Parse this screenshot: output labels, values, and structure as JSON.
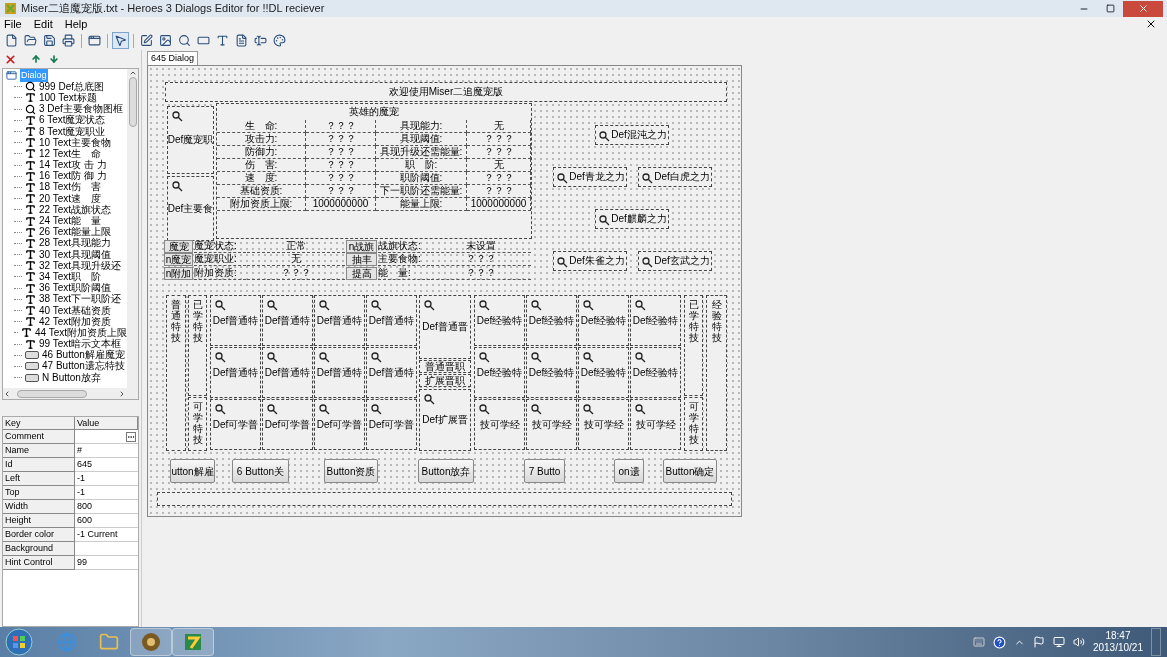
{
  "window": {
    "title": "Miser二追魔宠版.txt - Heroes 3 Dialogs Editor for !!DL reciever"
  },
  "menu": [
    {
      "label": "File"
    },
    {
      "label": "Edit"
    },
    {
      "label": "Help"
    }
  ],
  "toolbar": [
    {
      "kind": "new",
      "selected": false
    },
    {
      "kind": "open",
      "selected": false
    },
    {
      "kind": "save",
      "selected": false
    },
    {
      "kind": "print",
      "selected": false
    },
    {
      "kind": "dialog",
      "selected": false
    },
    {
      "kind": "pointer",
      "selected": true
    },
    {
      "kind": "edit",
      "selected": false
    },
    {
      "kind": "image",
      "selected": false
    },
    {
      "kind": "def",
      "selected": false
    },
    {
      "kind": "button",
      "selected": false
    },
    {
      "kind": "text",
      "selected": false
    },
    {
      "kind": "list",
      "selected": false
    },
    {
      "kind": "textbox",
      "selected": false
    },
    {
      "kind": "palette",
      "selected": false
    }
  ],
  "tree": {
    "label": "Dialog",
    "selected": true,
    "children": [
      {
        "kind": "def",
        "label": "999 Def总底图",
        "selected": false
      },
      {
        "kind": "text",
        "label": "100 Text标题",
        "selected": false
      },
      {
        "kind": "def",
        "label": "3 Def主要食物图框",
        "selected": false
      },
      {
        "kind": "text",
        "label": "6 Text魔宠状态",
        "selected": false
      },
      {
        "kind": "text",
        "label": "8 Text魔宠职业",
        "selected": false
      },
      {
        "kind": "text",
        "label": "10 Text主要食物",
        "selected": false
      },
      {
        "kind": "text",
        "label": "12 Text生　命",
        "selected": false
      },
      {
        "kind": "text",
        "label": "14 Text攻 击 力",
        "selected": false
      },
      {
        "kind": "text",
        "label": "16 Text防 御 力",
        "selected": false
      },
      {
        "kind": "text",
        "label": "18 Text伤　害",
        "selected": false
      },
      {
        "kind": "text",
        "label": "20 Text速　度",
        "selected": false
      },
      {
        "kind": "text",
        "label": "22 Text战旗状态",
        "selected": false
      },
      {
        "kind": "text",
        "label": "24 Text能　量",
        "selected": false
      },
      {
        "kind": "text",
        "label": "26 Text能量上限",
        "selected": false
      },
      {
        "kind": "text",
        "label": "28 Text具现能力",
        "selected": false
      },
      {
        "kind": "text",
        "label": "30 Text具现阈值",
        "selected": false
      },
      {
        "kind": "text",
        "label": "32 Text具现升级还",
        "selected": false
      },
      {
        "kind": "text",
        "label": "34 Text职　阶",
        "selected": false
      },
      {
        "kind": "text",
        "label": "36 Text职阶阈值",
        "selected": false
      },
      {
        "kind": "text",
        "label": "38 Text下一职阶还",
        "selected": false
      },
      {
        "kind": "text",
        "label": "40 Text基础资质",
        "selected": false
      },
      {
        "kind": "text",
        "label": "42 Text附加资质",
        "selected": false
      },
      {
        "kind": "text",
        "label": "44 Text附加资质上限",
        "selected": false
      },
      {
        "kind": "text",
        "label": "99 Text暗示文本框",
        "selected": false
      },
      {
        "kind": "button",
        "label": "46 Button解雇魔宠",
        "selected": false
      },
      {
        "kind": "button",
        "label": "47 Button遗忘特技",
        "selected": false
      },
      {
        "kind": "button",
        "label": "N Button放弃",
        "selected": false
      }
    ]
  },
  "properties": {
    "columns": [
      "Key",
      "Value"
    ],
    "rows": [
      {
        "key": "Comment",
        "value": "",
        "has_button": true
      },
      {
        "key": "Name",
        "value": "#",
        "has_button": false
      },
      {
        "key": "Id",
        "value": "645",
        "has_button": false
      },
      {
        "key": "Left",
        "value": "-1",
        "has_button": false
      },
      {
        "key": "Top",
        "value": "-1",
        "has_button": false
      },
      {
        "key": "Width",
        "value": "800",
        "has_button": false
      },
      {
        "key": "Height",
        "value": "600",
        "has_button": false
      },
      {
        "key": "Border color",
        "value": "-1 Current",
        "has_button": false
      },
      {
        "key": "Background",
        "value": "",
        "has_button": false
      },
      {
        "key": "Hint Control",
        "value": "99",
        "has_button": false
      }
    ]
  },
  "tabs": [
    {
      "label": "645 Dialog",
      "selected": true
    }
  ],
  "canvas": {
    "header": "欢迎使用Miser二追魔宠版",
    "left_defs": [
      "Def魔宠职",
      "Def主要食"
    ],
    "panel_title": "英雄的魔宠",
    "stats": [
      [
        "生　命:",
        "？？？",
        "具现能力:",
        "无"
      ],
      [
        "攻击力:",
        "？？？",
        "具现阈值:",
        "？？？"
      ],
      [
        "防御力:",
        "？？？",
        "具现升级还需能量:",
        "？？？"
      ],
      [
        "伤　害:",
        "？？？",
        "职　阶:",
        "无"
      ],
      [
        "速　度:",
        "？？？",
        "职阶阈值:",
        "？？？"
      ],
      [
        "基础资质:",
        "？？？",
        "下一职阶还需能量:",
        "？？？"
      ],
      [
        "附加资质上限:",
        "1000000000",
        "能量上限:",
        "1000000000"
      ]
    ],
    "status": [
      [
        "魔宠",
        "魔宠状态:",
        "正常",
        "n战旗",
        "战旗状态:",
        "未设置"
      ],
      [
        "n魔宠",
        "魔宠职业:",
        "无",
        "抽丰",
        "主要食物:",
        "？？？"
      ],
      [
        "n附加",
        "附加资质:",
        "？？？",
        "提高",
        "能　量:",
        "？？？"
      ]
    ],
    "powers": [
      "Def混沌之力",
      "Def青龙之力",
      "Def白虎之力",
      "Def麒麟之力",
      "Def朱雀之力",
      "Def玄武之力"
    ],
    "side_labels": [
      "普通特技",
      "已学特技",
      "可学特技",
      "已学特技",
      "可学特技",
      "经验特技"
    ],
    "skill_rows": [
      [
        "Def普通特",
        "Def普通特",
        "Def普通特",
        "Def普通特",
        "Def经验特",
        "Def经验特",
        "Def经验特",
        "Def经验特"
      ],
      [
        "Def普通特",
        "Def普通特",
        "Def普通特",
        "Def普通特",
        "Def经验特",
        "Def经验特",
        "Def经验特",
        "Def经验特"
      ],
      [
        "Def可学普",
        "Def可学普",
        "Def可学普",
        "Def可学普",
        "技可学经",
        "技可学经",
        "技可学经",
        "技可学经"
      ]
    ],
    "center": [
      "Def普通晋",
      "普通晋职",
      "扩展晋职",
      "Def扩展晋"
    ],
    "buttons": [
      "utton解雇",
      "6 Button关",
      "Button资质",
      "Button放弃",
      "7 Butto",
      "on遗",
      "Button确定"
    ]
  },
  "taskbar": {
    "time": "18:47",
    "date": "2013/10/21"
  }
}
